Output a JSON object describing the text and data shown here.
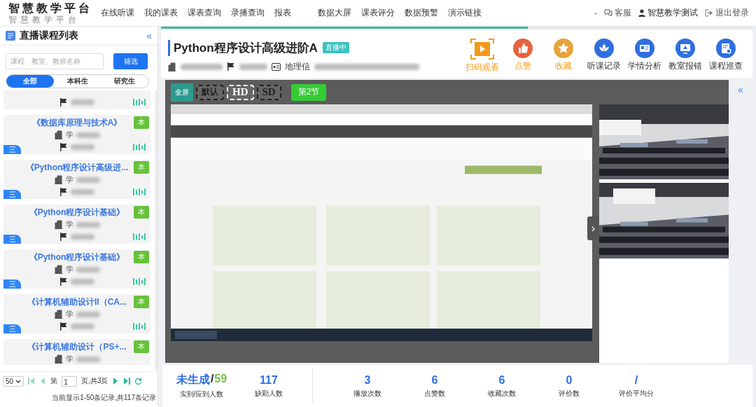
{
  "brand": {
    "title": "智慧教学平台",
    "subtitle": "智慧教学平台"
  },
  "nav": [
    "在线听课",
    "我的课表",
    "课表查询",
    "录播查询",
    "报表",
    "数据大屏",
    "课表评分",
    "数据预警",
    "演示链接"
  ],
  "user_lead": "-",
  "user_menu": [
    {
      "kind": "service",
      "label": "客服"
    },
    {
      "kind": "user",
      "label": "智慧教学测试"
    },
    {
      "kind": "logout",
      "label": "退出登录"
    }
  ],
  "sidebar": {
    "title": "直播课程列表",
    "collapse": "«",
    "search": {
      "placeholder": "课程、教室、教师名称"
    },
    "filter_button": "筛选",
    "tabs": [
      {
        "label": "全部",
        "selected": true
      },
      {
        "label": "本科生",
        "selected": false
      },
      {
        "label": "研究生",
        "selected": false
      }
    ],
    "courses": [
      {
        "kind": "top_cut"
      },
      {
        "kind": "full",
        "title": "《数据库原理与技术A》",
        "room": "学",
        "badge": "本",
        "weekday": "三"
      },
      {
        "kind": "full",
        "title": "《Python程序设计高级进...",
        "room": "学",
        "badge": "本",
        "weekday": "三"
      },
      {
        "kind": "full",
        "title": "《Python程序设计基础》",
        "room": "学",
        "badge": "本",
        "weekday": "三"
      },
      {
        "kind": "full",
        "title": "《Python程序设计基础》",
        "room": "学",
        "badge": "本",
        "weekday": "三"
      },
      {
        "kind": "full",
        "title": "《计算机辅助设计II（CA...",
        "room": "学",
        "badge": "本",
        "weekday": "三"
      },
      {
        "kind": "bottom_cut",
        "title": "《计算机辅助设计（PS+...",
        "room": "学",
        "badge": "本"
      }
    ],
    "pager": {
      "page_size": "50",
      "page_prefix": "第",
      "page": "1",
      "page_suffix": "页,共3页",
      "summary": "当前显示1-50条记录,共117条记录"
    }
  },
  "loading": {
    "level": 0.62
  },
  "course": {
    "title": "Python程序设计高级进阶A",
    "status": "直播中",
    "class_name": "地理信",
    "actions": [
      {
        "kind": "qr",
        "label": "扫码观看"
      },
      {
        "kind": "like",
        "label": "点赞"
      },
      {
        "kind": "star",
        "label": "收藏"
      },
      {
        "kind": "record",
        "label": "听课记录"
      },
      {
        "kind": "analysis",
        "label": "学情分析"
      },
      {
        "kind": "report",
        "label": "教室报错"
      },
      {
        "kind": "inspect",
        "label": "课程巡查"
      }
    ]
  },
  "player": {
    "fullscreen": "全屏",
    "quality": [
      {
        "label": "默认",
        "selected": false
      },
      {
        "label": "HD",
        "selected": true
      },
      {
        "label": "SD",
        "selected": false
      }
    ],
    "session": "第2节",
    "toggle": "›",
    "collapse": "«"
  },
  "stats": [
    {
      "kind": "ratio",
      "value": "未生成",
      "separator": "/",
      "total": "59",
      "label": "实到/应到人数"
    },
    {
      "kind": "plain",
      "value": "117",
      "label": "缺勤人数"
    },
    {
      "kind": "divider"
    },
    {
      "kind": "plain",
      "value": "3",
      "label": "播放次数"
    },
    {
      "kind": "plain",
      "value": "6",
      "label": "点赞数"
    },
    {
      "kind": "plain",
      "value": "6",
      "label": "收藏次数"
    },
    {
      "kind": "plain",
      "value": "0",
      "label": "评价数"
    },
    {
      "kind": "plain",
      "value": "/",
      "label": "评价平均分"
    }
  ]
}
